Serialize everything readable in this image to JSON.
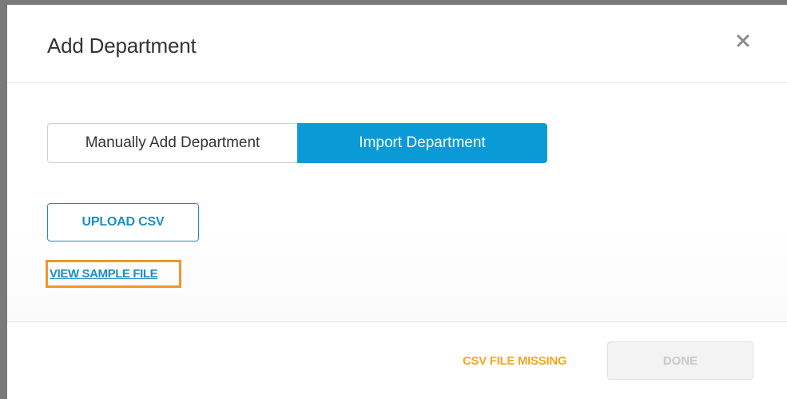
{
  "modal": {
    "title": "Add Department"
  },
  "tabs": [
    {
      "label": "Manually Add Department",
      "active": false
    },
    {
      "label": "Import Department",
      "active": true
    }
  ],
  "actions": {
    "upload_label": "UPLOAD CSV",
    "sample_link_label": "VIEW SAMPLE FILE"
  },
  "footer": {
    "status": "CSV FILE MISSING",
    "done_label": "DONE"
  },
  "colors": {
    "accent": "#0a9bd6",
    "link": "#1a8fc4",
    "warning": "#f5a623",
    "highlight": "#f0962e",
    "disabled_text": "#c8c8c8"
  },
  "icons": {
    "close": "close-icon"
  }
}
